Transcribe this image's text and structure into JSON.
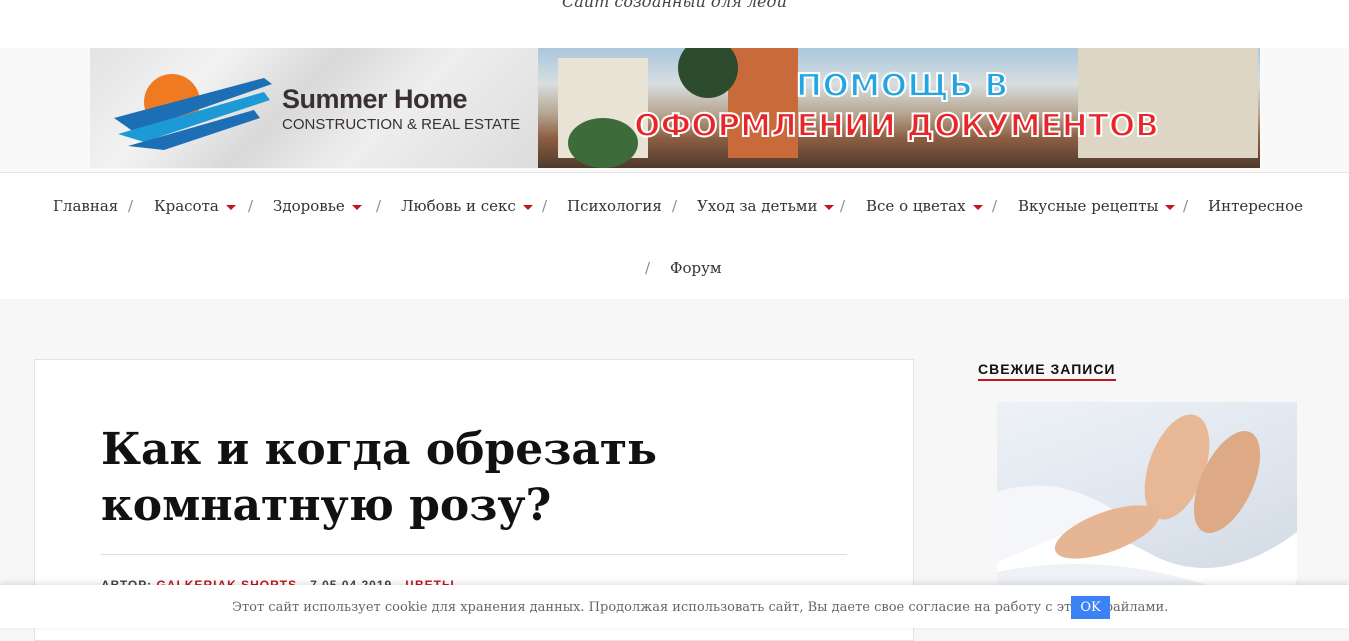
{
  "site": {
    "tagline": "Сайт созданный для леди"
  },
  "banner": {
    "brand_name": "Summer Home",
    "brand_sub": "CONSTRUCTION & REAL ESTATE",
    "promo_line1": "ПОМОЩЬ В",
    "promo_line2": "ОФОРМЛЕНИИ ДОКУМЕНТОВ"
  },
  "nav": {
    "separator": "/",
    "items": [
      {
        "label": "Главная",
        "has_dropdown": false
      },
      {
        "label": "Красота",
        "has_dropdown": true
      },
      {
        "label": "Здоровье",
        "has_dropdown": true
      },
      {
        "label": "Любовь и секс",
        "has_dropdown": true
      },
      {
        "label": "Психология",
        "has_dropdown": false
      },
      {
        "label": "Уход за детьми",
        "has_dropdown": true
      },
      {
        "label": "Все о цветах",
        "has_dropdown": true
      },
      {
        "label": "Вкусные рецепты",
        "has_dropdown": true
      },
      {
        "label": "Интересное",
        "has_dropdown": false
      },
      {
        "label": "Форум",
        "has_dropdown": false
      }
    ]
  },
  "article": {
    "title": "Как и когда обрезать комнатную розу?",
    "meta_author_prefix": "АВТОР:",
    "meta_author": "GALKERIAK SHORTS",
    "meta_date": "7 05.04.2019",
    "meta_category": "ЦВЕТЫ"
  },
  "sidebar": {
    "widget_title": "СВЕЖИЕ ЗАПИСИ"
  },
  "cookie": {
    "text": "Этот сайт использует cookie для хранения данных. Продолжая использовать сайт, Вы даете свое согласие на работу с этими файлами.",
    "ok_label": "OK"
  },
  "colors": {
    "accent": "#c0171d",
    "button": "#3b82f6"
  }
}
